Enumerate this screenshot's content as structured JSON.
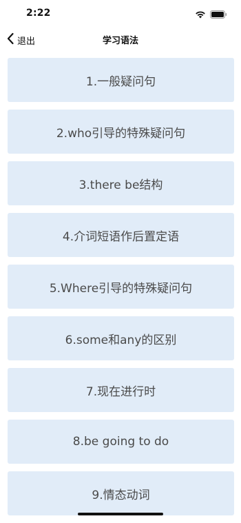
{
  "status_bar": {
    "time": "2:22",
    "icons": [
      "wifi-icon",
      "battery-icon"
    ]
  },
  "nav": {
    "back_label": "退出",
    "back_icon": "chevron-left-icon",
    "title": "学习语法"
  },
  "items": [
    {
      "label": "1.一般疑问句"
    },
    {
      "label": "2.who引导的特殊疑问句"
    },
    {
      "label": "3.there be结构"
    },
    {
      "label": "4.介词短语作后置定语"
    },
    {
      "label": "5.Where引导的特殊疑问句"
    },
    {
      "label": "6.some和any的区别"
    },
    {
      "label": "7.现在进行时"
    },
    {
      "label": "8.be going to do"
    },
    {
      "label": "9.情态动词"
    }
  ],
  "colors": {
    "item_background": "#e1ecf8",
    "item_text": "#4a4a4a"
  }
}
